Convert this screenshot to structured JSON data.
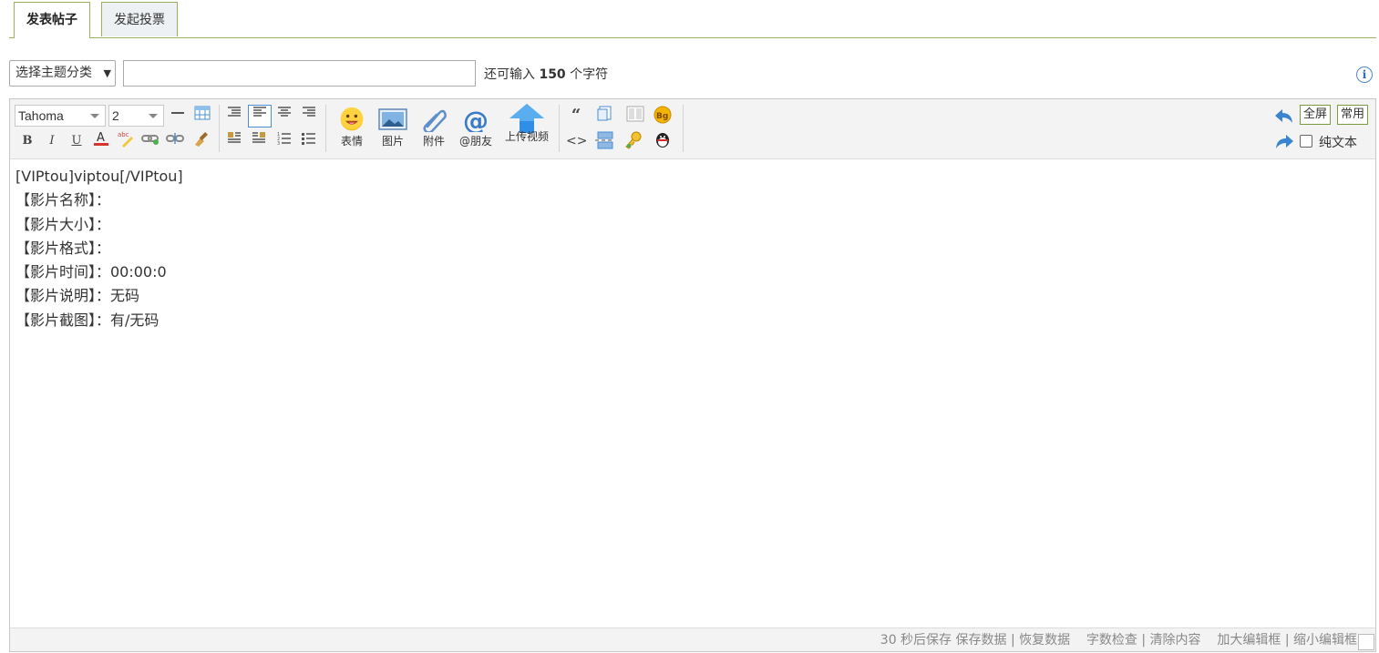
{
  "tabs": [
    {
      "label": "发表帖子"
    },
    {
      "label": "发起投票"
    }
  ],
  "category_select": {
    "value": "选择主题分类"
  },
  "title_input": {
    "value": "",
    "placeholder": ""
  },
  "char_count": {
    "prefix": "还可输入",
    "count": "150",
    "suffix": "个字符"
  },
  "info_icon": "i",
  "toolbar": {
    "font": "Tahoma",
    "size": "2",
    "emoji_label": "表情",
    "image_label": "图片",
    "attach_label": "附件",
    "at_label": "@朋友",
    "video_label": "上传视频",
    "fullscreen_label": "全屏",
    "common_label": "常用",
    "plaintext_label": "纯文本"
  },
  "content": {
    "lines": [
      "[VIPtou]viptou[/VIPtou]",
      "【影片名称】：",
      "【影片大小】：",
      "【影片格式】：",
      "【影片时间】：00:00:0",
      "【影片说明】：无码",
      "【影片截图】：有/无码"
    ]
  },
  "status": {
    "autosave": "30 秒后保存",
    "save": "保存数据",
    "restore": "恢复数据",
    "wordcheck": "字数检查",
    "clear": "清除内容",
    "enlarge": "加大编辑框",
    "shrink": "缩小编辑框",
    "sep": "|"
  },
  "colors": {
    "accent": "#9ab15a",
    "link_blue": "#4a8ed6",
    "toolbar_bg": "#f3f3f3"
  }
}
